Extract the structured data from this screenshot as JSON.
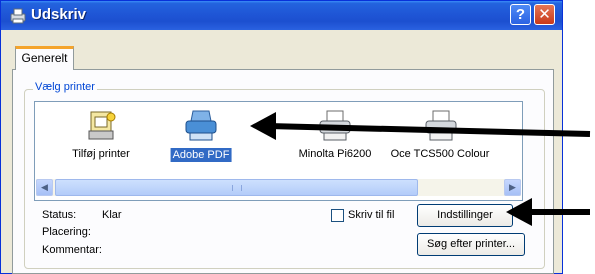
{
  "window": {
    "title": "Udskriv"
  },
  "titlebar_buttons": {
    "help": "?",
    "close": "✕"
  },
  "tabs": [
    {
      "label": "Generelt"
    }
  ],
  "printer_group": {
    "label": "Vælg printer",
    "printers": [
      {
        "label": "Tilføj printer",
        "icon": "add-printer-icon"
      },
      {
        "label": "Adobe PDF",
        "icon": "printer-icon",
        "selected": true
      },
      {
        "label": "Minolta Pi6200",
        "icon": "printer-icon"
      },
      {
        "label": "Oce TCS500 Colour",
        "icon": "printer-icon"
      }
    ]
  },
  "status": {
    "status_label": "Status:",
    "status_value": "Klar",
    "location_label": "Placering:",
    "comment_label": "Kommentar:"
  },
  "print_to_file": {
    "label": "Skriv til fil",
    "checked": false
  },
  "buttons": {
    "settings": "Indstillinger",
    "find_printer": "Søg efter printer..."
  },
  "colors": {
    "titlebar": "#1f56d6",
    "selection": "#316ac5",
    "tab_highlight": "#f4a42c"
  }
}
